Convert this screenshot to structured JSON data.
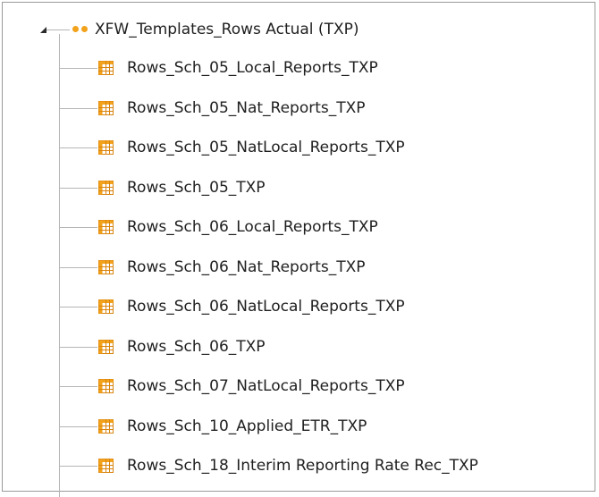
{
  "tree": {
    "root": {
      "label": "XFW_Templates_Rows Actual (TXP)",
      "icon": "rows-folder-dots-icon",
      "expanded": true
    },
    "items": [
      {
        "label": "Rows_Sch_05_Local_Reports_TXP",
        "icon": "table-icon"
      },
      {
        "label": "Rows_Sch_05_Nat_Reports_TXP",
        "icon": "table-icon"
      },
      {
        "label": "Rows_Sch_05_NatLocal_Reports_TXP",
        "icon": "table-icon"
      },
      {
        "label": "Rows_Sch_05_TXP",
        "icon": "table-icon"
      },
      {
        "label": "Rows_Sch_06_Local_Reports_TXP",
        "icon": "table-icon"
      },
      {
        "label": "Rows_Sch_06_Nat_Reports_TXP",
        "icon": "table-icon"
      },
      {
        "label": "Rows_Sch_06_NatLocal_Reports_TXP",
        "icon": "table-icon"
      },
      {
        "label": "Rows_Sch_06_TXP",
        "icon": "table-icon"
      },
      {
        "label": "Rows_Sch_07_NatLocal_Reports_TXP",
        "icon": "table-icon"
      },
      {
        "label": "Rows_Sch_10_Applied_ETR_TXP",
        "icon": "table-icon"
      },
      {
        "label": "Rows_Sch_18_Interim Reporting Rate Rec_TXP",
        "icon": "table-icon"
      }
    ]
  },
  "colors": {
    "icon_orange": "#f2a21b",
    "icon_dark_orange": "#d9840f",
    "connector": "#b5b5b5",
    "text": "#1f1f1f",
    "border": "#9a9a9a"
  }
}
